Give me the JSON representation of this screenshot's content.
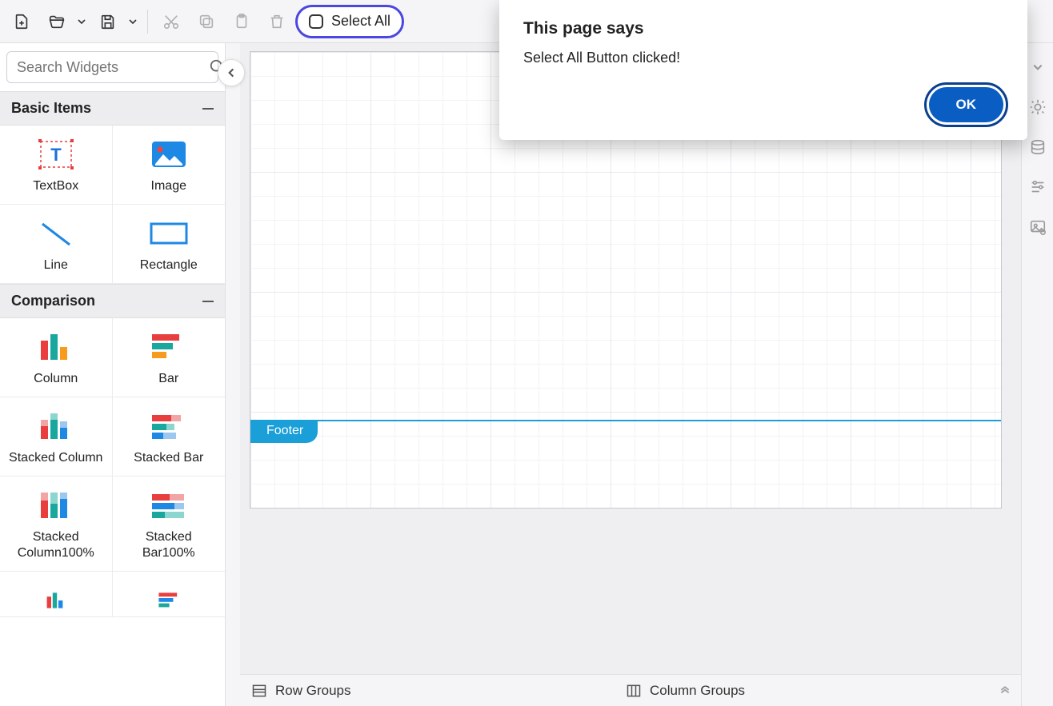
{
  "toolbar": {
    "select_all_label": "Select All"
  },
  "search": {
    "placeholder": "Search Widgets"
  },
  "groups": {
    "basic": {
      "title": "Basic Items",
      "items": [
        "TextBox",
        "Image",
        "Line",
        "Rectangle"
      ]
    },
    "comparison": {
      "title": "Comparison",
      "items": [
        "Column",
        "Bar",
        "Stacked Column",
        "Stacked Bar",
        "Stacked Column100%",
        "Stacked Bar100%"
      ]
    }
  },
  "canvas": {
    "footer_label": "Footer"
  },
  "bottom": {
    "row_groups": "Row Groups",
    "column_groups": "Column Groups"
  },
  "dialog": {
    "title": "This page says",
    "message": "Select All Button clicked!",
    "ok": "OK"
  }
}
